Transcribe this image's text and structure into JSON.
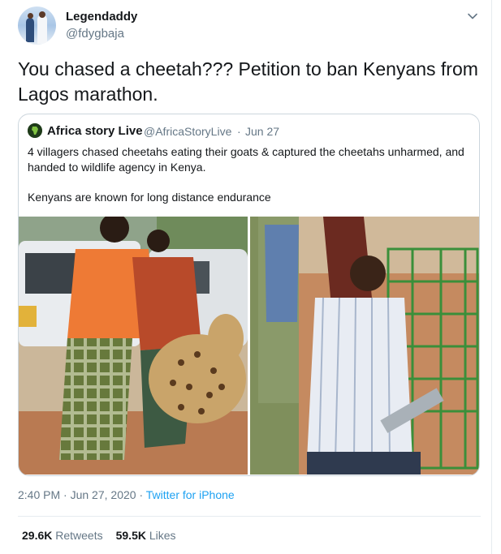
{
  "author": {
    "display_name": "Legendaddy",
    "handle": "@fdygbaja"
  },
  "tweet": {
    "text": "You chased a cheetah??? Petition to ban Kenyans from Lagos marathon."
  },
  "quoted_tweet": {
    "display_name": "Africa story Live",
    "handle": "@AfricaStoryLive",
    "separator": "·",
    "date": "Jun 27",
    "text_paragraph_1": "4 villagers chased cheetahs eating their goats & captured the cheetahs unharmed, and handed to wildlife agency in Kenya.",
    "text_paragraph_2": "Kenyans are known for long distance endurance",
    "photos": [
      {
        "icon": "photo-men-carrying-cheetah"
      },
      {
        "icon": "photo-man-with-cheetah-cage"
      }
    ]
  },
  "meta": {
    "time": "2:40 PM",
    "separator_1": "·",
    "date": "Jun 27, 2020",
    "separator_2": "·",
    "source": "Twitter for iPhone"
  },
  "stats": {
    "retweets_count": "29.6K",
    "retweets_label": "Retweets",
    "likes_count": "59.5K",
    "likes_label": "Likes"
  },
  "colors": {
    "link": "#1da1f2",
    "secondary_text": "#657786",
    "primary_text": "#14171a",
    "border": "#ccd6dd"
  }
}
